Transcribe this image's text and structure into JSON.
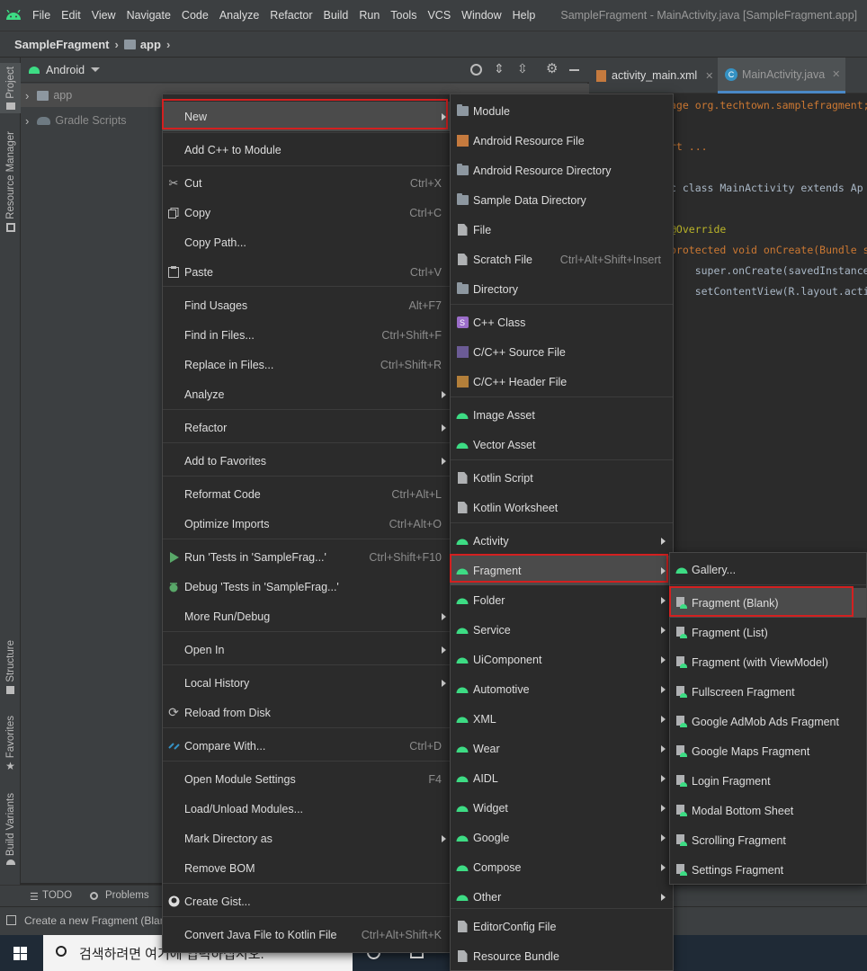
{
  "menubar": {
    "items": [
      "File",
      "Edit",
      "View",
      "Navigate",
      "Code",
      "Analyze",
      "Refactor",
      "Build",
      "Run",
      "Tools",
      "VCS",
      "Window",
      "Help"
    ],
    "title": "SampleFragment - MainActivity.java [SampleFragment.app]"
  },
  "navbar": {
    "project": "SampleFragment",
    "module": "app"
  },
  "side_tabs": {
    "project": "Project",
    "resource_manager": "Resource Manager",
    "structure": "Structure",
    "favorites": "Favorites",
    "build_variants": "Build Variants"
  },
  "project_panel": {
    "view_mode": "Android",
    "tree": [
      "app",
      "Gradle Scripts"
    ]
  },
  "editor": {
    "tabs": [
      {
        "label": "activity_main.xml"
      },
      {
        "label": "MainActivity.java"
      }
    ],
    "code_lines": [
      "age org.techtown.samplefragment;",
      "rt ...",
      "c class MainActivity extends Ap",
      "@Override",
      "protected void onCreate(Bundle s",
      "    super.onCreate(savedInstance",
      "    setContentView(R.layout.acti"
    ]
  },
  "bottom_tabs": {
    "todo": "TODO",
    "problems": "Problems"
  },
  "status": {
    "text": "Create a new Fragment (Blan"
  },
  "taskbar": {
    "search_placeholder": "검색하려면 여기에 입력하십시오."
  },
  "context_menu": {
    "items": [
      {
        "label": "New",
        "shortcut": "",
        "submenu": true
      },
      {
        "label": "Add C++ to Module",
        "shortcut": ""
      },
      {
        "label": "Cut",
        "shortcut": "Ctrl+X"
      },
      {
        "label": "Copy",
        "shortcut": "Ctrl+C"
      },
      {
        "label": "Copy Path...",
        "shortcut": ""
      },
      {
        "label": "Paste",
        "shortcut": "Ctrl+V"
      },
      {
        "label": "Find Usages",
        "shortcut": "Alt+F7"
      },
      {
        "label": "Find in Files...",
        "shortcut": "Ctrl+Shift+F"
      },
      {
        "label": "Replace in Files...",
        "shortcut": "Ctrl+Shift+R"
      },
      {
        "label": "Analyze",
        "shortcut": "",
        "submenu": true
      },
      {
        "label": "Refactor",
        "shortcut": "",
        "submenu": true
      },
      {
        "label": "Add to Favorites",
        "shortcut": "",
        "submenu": true
      },
      {
        "label": "Reformat Code",
        "shortcut": "Ctrl+Alt+L"
      },
      {
        "label": "Optimize Imports",
        "shortcut": "Ctrl+Alt+O"
      },
      {
        "label": "Run 'Tests in 'SampleFrag...'",
        "shortcut": "Ctrl+Shift+F10"
      },
      {
        "label": "Debug 'Tests in 'SampleFrag...'",
        "shortcut": ""
      },
      {
        "label": "More Run/Debug",
        "shortcut": "",
        "submenu": true
      },
      {
        "label": "Open In",
        "shortcut": "",
        "submenu": true
      },
      {
        "label": "Local History",
        "shortcut": "",
        "submenu": true
      },
      {
        "label": "Reload from Disk",
        "shortcut": ""
      },
      {
        "label": "Compare With...",
        "shortcut": "Ctrl+D"
      },
      {
        "label": "Open Module Settings",
        "shortcut": "F4"
      },
      {
        "label": "Load/Unload Modules...",
        "shortcut": ""
      },
      {
        "label": "Mark Directory as",
        "shortcut": "",
        "submenu": true
      },
      {
        "label": "Remove BOM",
        "shortcut": ""
      },
      {
        "label": "Create Gist...",
        "shortcut": ""
      },
      {
        "label": "Convert Java File to Kotlin File",
        "shortcut": "Ctrl+Alt+Shift+K"
      }
    ]
  },
  "new_submenu": {
    "items": [
      {
        "label": "Module",
        "shortcut": ""
      },
      {
        "label": "Android Resource File",
        "shortcut": ""
      },
      {
        "label": "Android Resource Directory",
        "shortcut": ""
      },
      {
        "label": "Sample Data Directory",
        "shortcut": ""
      },
      {
        "label": "File",
        "shortcut": ""
      },
      {
        "label": "Scratch File",
        "shortcut": "Ctrl+Alt+Shift+Insert"
      },
      {
        "label": "Directory",
        "shortcut": ""
      },
      {
        "label": "C++ Class",
        "shortcut": ""
      },
      {
        "label": "C/C++ Source File",
        "shortcut": ""
      },
      {
        "label": "C/C++ Header File",
        "shortcut": ""
      },
      {
        "label": "Image Asset",
        "shortcut": ""
      },
      {
        "label": "Vector Asset",
        "shortcut": ""
      },
      {
        "label": "Kotlin Script",
        "shortcut": ""
      },
      {
        "label": "Kotlin Worksheet",
        "shortcut": ""
      },
      {
        "label": "Activity",
        "shortcut": "",
        "submenu": true
      },
      {
        "label": "Fragment",
        "shortcut": "",
        "submenu": true
      },
      {
        "label": "Folder",
        "shortcut": "",
        "submenu": true
      },
      {
        "label": "Service",
        "shortcut": "",
        "submenu": true
      },
      {
        "label": "UiComponent",
        "shortcut": "",
        "submenu": true
      },
      {
        "label": "Automotive",
        "shortcut": "",
        "submenu": true
      },
      {
        "label": "XML",
        "shortcut": "",
        "submenu": true
      },
      {
        "label": "Wear",
        "shortcut": "",
        "submenu": true
      },
      {
        "label": "AIDL",
        "shortcut": "",
        "submenu": true
      },
      {
        "label": "Widget",
        "shortcut": "",
        "submenu": true
      },
      {
        "label": "Google",
        "shortcut": "",
        "submenu": true
      },
      {
        "label": "Compose",
        "shortcut": "",
        "submenu": true
      },
      {
        "label": "Other",
        "shortcut": "",
        "submenu": true
      },
      {
        "label": "EditorConfig File",
        "shortcut": ""
      },
      {
        "label": "Resource Bundle",
        "shortcut": ""
      }
    ]
  },
  "fragment_submenu": {
    "items": [
      {
        "label": "Gallery..."
      },
      {
        "label": "Fragment (Blank)"
      },
      {
        "label": "Fragment (List)"
      },
      {
        "label": "Fragment (with ViewModel)"
      },
      {
        "label": "Fullscreen Fragment"
      },
      {
        "label": "Google AdMob Ads Fragment"
      },
      {
        "label": "Google Maps Fragment"
      },
      {
        "label": "Login Fragment"
      },
      {
        "label": "Modal Bottom Sheet"
      },
      {
        "label": "Scrolling Fragment"
      },
      {
        "label": "Settings Fragment"
      }
    ]
  },
  "colors": {
    "highlight_box": "#d32020",
    "android_green": "#3ddc84",
    "selection": "#4b4b4b"
  }
}
